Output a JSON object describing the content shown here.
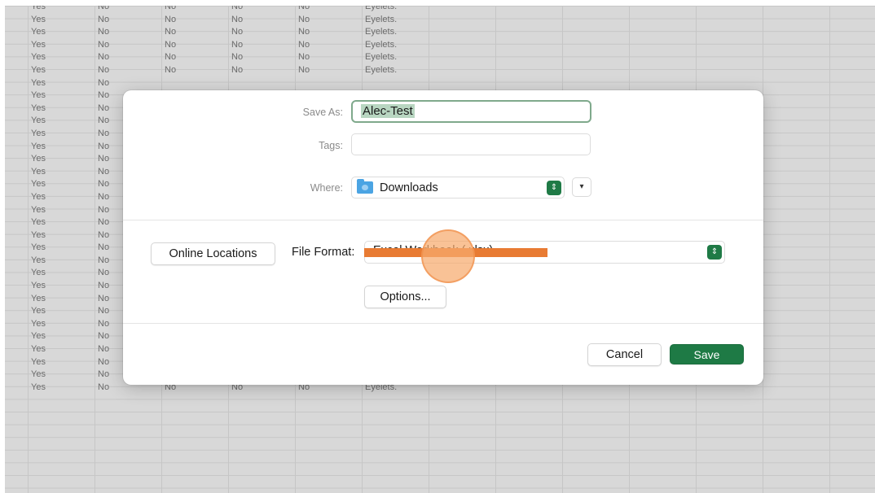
{
  "sheet": {
    "rows": [
      [
        "Yes",
        "No",
        "No",
        "No",
        "No",
        "Eyelets."
      ],
      [
        "Yes",
        "No",
        "No",
        "No",
        "No",
        "Eyelets."
      ],
      [
        "Yes",
        "No",
        "No",
        "No",
        "No",
        "Eyelets."
      ],
      [
        "Yes",
        "No",
        "No",
        "No",
        "No",
        "Eyelets."
      ],
      [
        "Yes",
        "No",
        "No",
        "No",
        "No",
        "Eyelets."
      ],
      [
        "Yes",
        "No",
        "No",
        "No",
        "No",
        "Eyelets."
      ],
      [
        "Yes",
        "No",
        "",
        "",
        "",
        ""
      ],
      [
        "Yes",
        "No",
        "",
        "",
        "",
        ""
      ],
      [
        "Yes",
        "No",
        "",
        "",
        "",
        ""
      ],
      [
        "Yes",
        "No",
        "",
        "",
        "",
        ""
      ],
      [
        "Yes",
        "No",
        "",
        "",
        "",
        ""
      ],
      [
        "Yes",
        "No",
        "",
        "",
        "",
        ""
      ],
      [
        "Yes",
        "No",
        "",
        "",
        "",
        ""
      ],
      [
        "Yes",
        "No",
        "",
        "",
        "",
        ""
      ],
      [
        "Yes",
        "No",
        "",
        "",
        "",
        ""
      ],
      [
        "Yes",
        "No",
        "",
        "",
        "",
        ""
      ],
      [
        "Yes",
        "No",
        "",
        "",
        "",
        ""
      ],
      [
        "Yes",
        "No",
        "",
        "",
        "",
        ""
      ],
      [
        "Yes",
        "No",
        "",
        "",
        "",
        ""
      ],
      [
        "Yes",
        "No",
        "",
        "",
        "",
        ""
      ],
      [
        "Yes",
        "No",
        "",
        "",
        "",
        ""
      ],
      [
        "Yes",
        "No",
        "",
        "",
        "",
        ""
      ],
      [
        "Yes",
        "No",
        "",
        "",
        "",
        ""
      ],
      [
        "Yes",
        "No",
        "",
        "",
        "",
        ""
      ],
      [
        "Yes",
        "No",
        "",
        "",
        "",
        ""
      ],
      [
        "Yes",
        "No",
        "",
        "",
        "",
        ""
      ],
      [
        "Yes",
        "No",
        "",
        "",
        "",
        ""
      ],
      [
        "Yes",
        "No",
        "",
        "",
        "",
        ""
      ],
      [
        "Yes",
        "No",
        "",
        "",
        "",
        ""
      ],
      [
        "Yes",
        "No",
        "",
        "",
        "",
        ""
      ],
      [
        "Yes",
        "No",
        "No",
        "No",
        "No",
        "Eyelets."
      ]
    ]
  },
  "dialog": {
    "save_as_label": "Save As:",
    "save_as_value": "Alec-Test",
    "tags_label": "Tags:",
    "tags_value": "",
    "where_label": "Where:",
    "where_value": "Downloads",
    "online_locations_label": "Online Locations",
    "file_format_label": "File Format:",
    "file_format_value": "Excel Workbook (.xlsx)",
    "options_label": "Options...",
    "cancel_label": "Cancel",
    "save_label": "Save"
  },
  "icons": {
    "folder": "folder-icon",
    "stepper": "up-down-stepper-icon",
    "expand": "chevron-down-icon"
  },
  "colors": {
    "accent": "#1e7a45",
    "selection": "#b8d6c1",
    "redaction": "#e87b33"
  }
}
